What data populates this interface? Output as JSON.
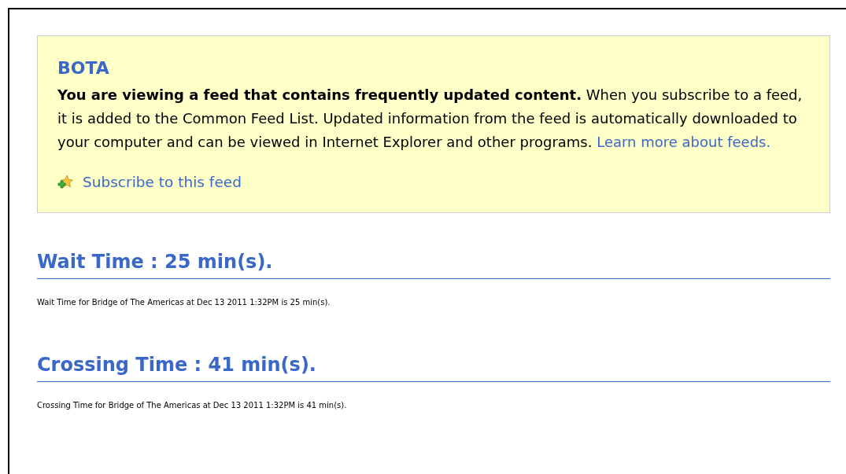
{
  "banner": {
    "title": "BOTA",
    "message": "**You are viewing a feed that contains frequently updated content.** When you subscribe to a feed, it is added to the Common Feed List. Updated information from the feed is automatically downloaded to your computer and can be viewed in Internet Explorer and other programs.",
    "learn_link": "Learn more about feeds.",
    "subscribe_link": "Subscribe to this feed"
  },
  "items": [
    {
      "heading": "Wait Time : 25 min(s).",
      "description": "Wait Time for Bridge of The Americas at Dec 13 2011 1:32PM is 25 min(s)."
    },
    {
      "heading": "Crossing Time : 41 min(s).",
      "description": "Crossing Time for Bridge of The Americas at Dec 13 2011 1:32PM is 41 min(s)."
    }
  ]
}
